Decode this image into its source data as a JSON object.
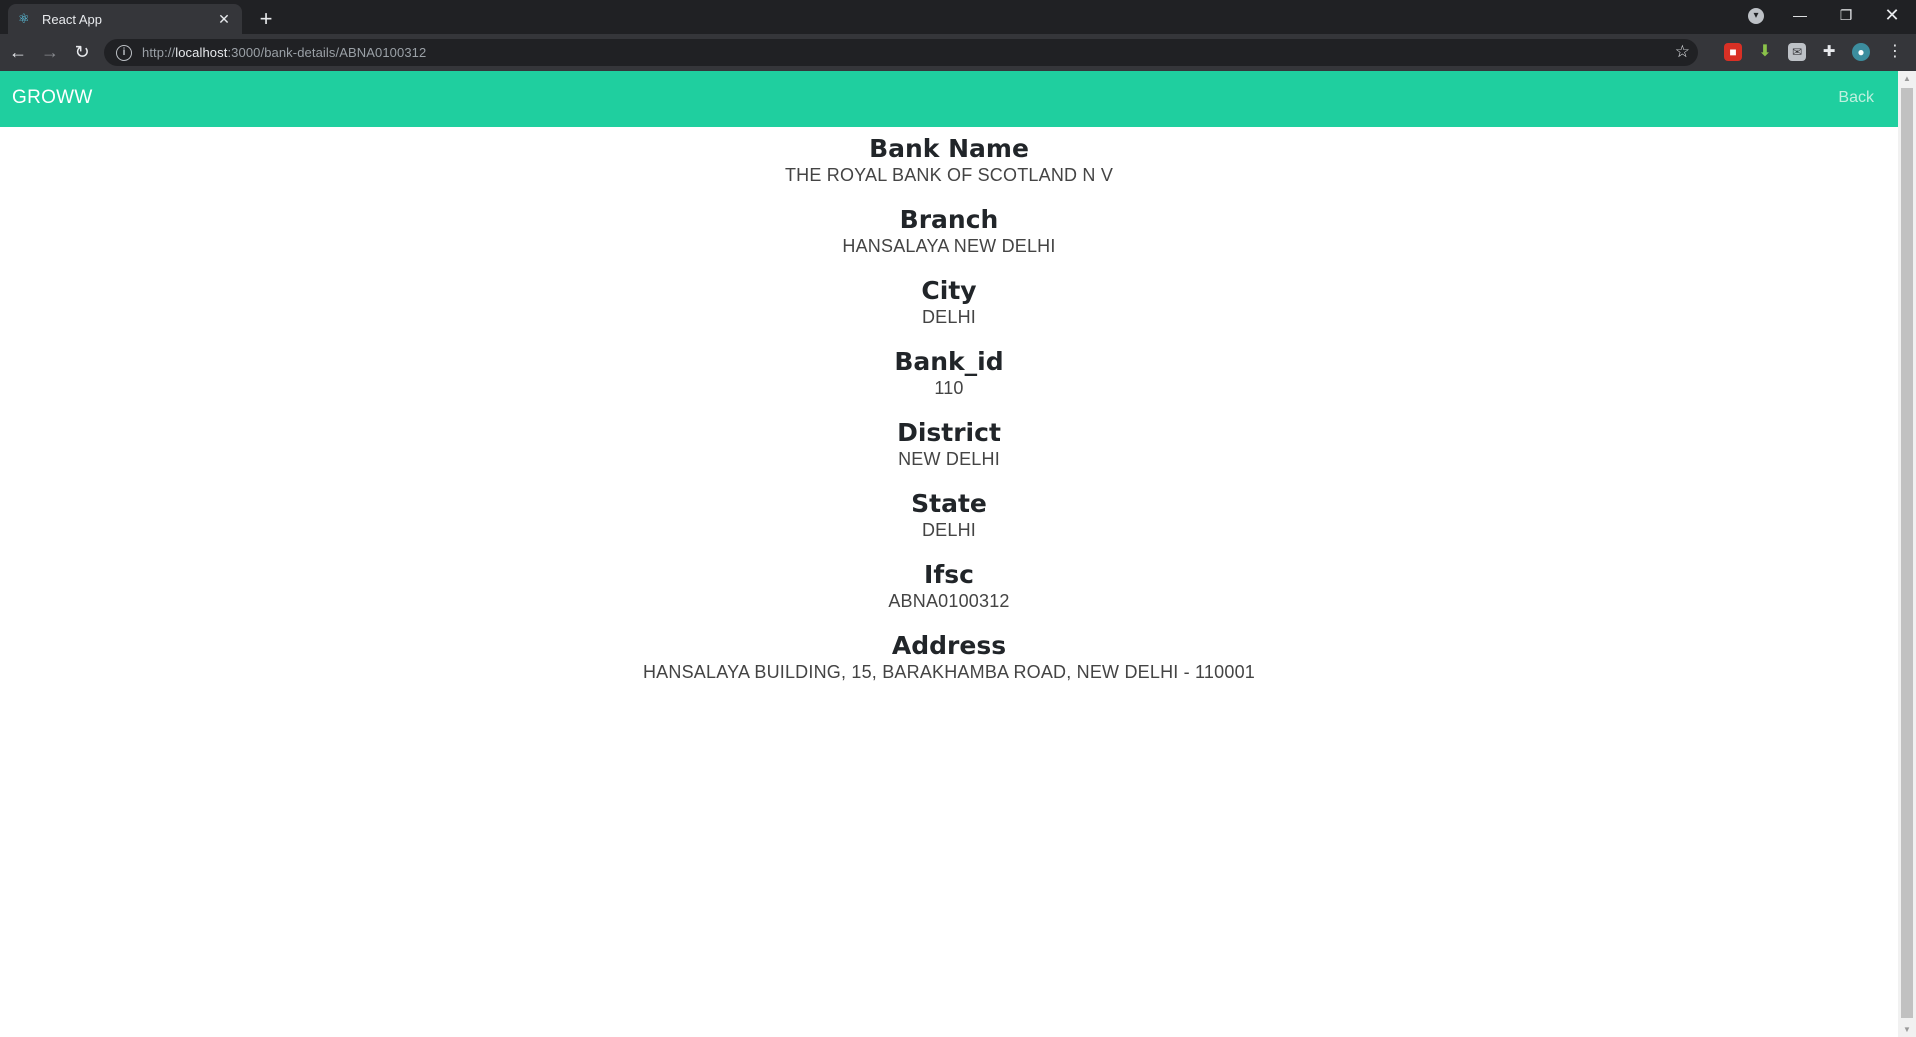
{
  "browser": {
    "tab_title": "React App",
    "url_prefix": "http://",
    "url_host": "localhost",
    "url_path": ":3000/bank-details/ABNA0100312",
    "icons": {
      "favicon": "react-icon",
      "close": "close-icon",
      "new_tab": "plus-icon",
      "back": "back-arrow-icon",
      "forward": "forward-arrow-icon",
      "reload": "reload-icon",
      "info": "info-icon",
      "bookmark": "star-icon",
      "extensions": "puzzle-icon",
      "menu": "kebab-menu-icon"
    }
  },
  "app": {
    "brand": "GROWW",
    "back_label": "Back",
    "accent_color": "#1fcf9f"
  },
  "details": [
    {
      "label": "Bank Name",
      "value": "THE ROYAL BANK OF SCOTLAND N V"
    },
    {
      "label": "Branch",
      "value": "HANSALAYA NEW DELHI"
    },
    {
      "label": "City",
      "value": "DELHI"
    },
    {
      "label": "Bank_id",
      "value": "110"
    },
    {
      "label": "District",
      "value": "NEW DELHI"
    },
    {
      "label": "State",
      "value": "DELHI"
    },
    {
      "label": "Ifsc",
      "value": "ABNA0100312"
    },
    {
      "label": "Address",
      "value": "HANSALAYA BUILDING, 15, BARAKHAMBA ROAD, NEW DELHI - 110001"
    }
  ]
}
